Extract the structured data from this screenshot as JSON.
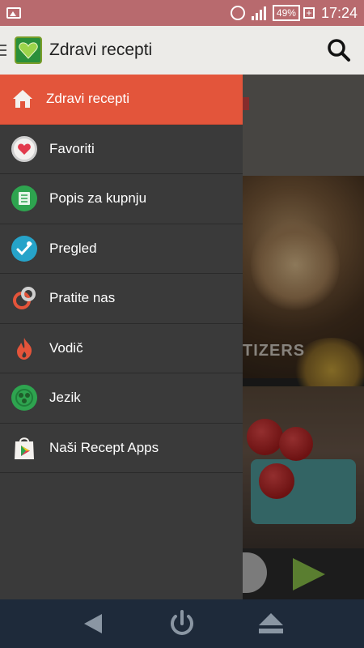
{
  "status_bar": {
    "battery": "49%",
    "time": "17:24"
  },
  "app_bar": {
    "title": "Zdravi recepti"
  },
  "background": {
    "category_text": "TIZERS"
  },
  "drawer": {
    "items": [
      {
        "label": "Zdravi recepti",
        "icon": "home-icon",
        "active": true
      },
      {
        "label": "Favoriti",
        "icon": "heart-icon",
        "active": false
      },
      {
        "label": "Popis za kupnju",
        "icon": "shopping-list-icon",
        "active": false
      },
      {
        "label": "Pregled",
        "icon": "review-icon",
        "active": false
      },
      {
        "label": "Pratite nas",
        "icon": "follow-icon",
        "active": false
      },
      {
        "label": "Vodič",
        "icon": "flame-icon",
        "active": false
      },
      {
        "label": "Jezik",
        "icon": "language-icon",
        "active": false
      },
      {
        "label": "Naši Recept Apps",
        "icon": "play-store-icon",
        "active": false
      }
    ]
  },
  "colors": {
    "active_item": "#e3553b",
    "drawer_bg": "#3a3a3a",
    "status_bar": "#b86a6e",
    "nav_bar": "#1e2a3a"
  }
}
